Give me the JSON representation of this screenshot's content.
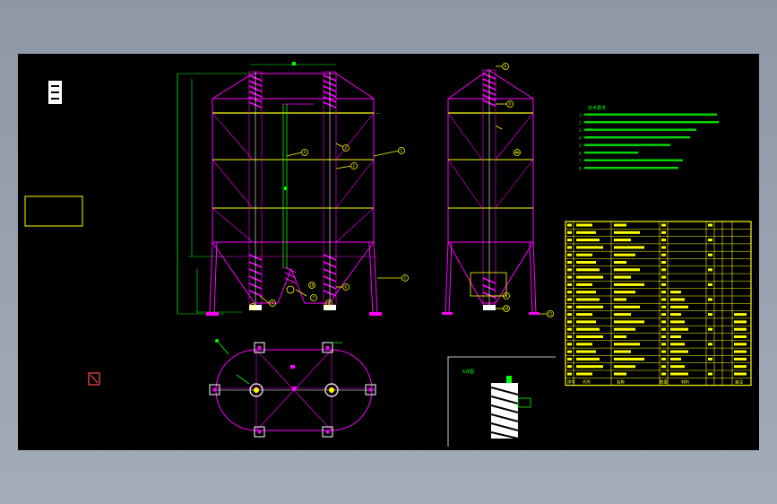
{
  "drawing": {
    "detail_label": "A详图",
    "notes_title": "技术要求",
    "notes": [
      "1.",
      "2.",
      "3.",
      "4.",
      "5.",
      "6.",
      "7.",
      "8."
    ],
    "balloons_front": [
      "1",
      "2",
      "3",
      "4",
      "5",
      "6",
      "7",
      "8",
      "9",
      "10",
      "11"
    ],
    "balloons_side": [
      "8",
      "9",
      "4",
      "5",
      "10",
      "11"
    ],
    "colors": {
      "background": "#000000",
      "magenta": "#ff00ff",
      "yellow": "#ffff00",
      "green": "#00ff00",
      "white": "#ffffff",
      "red": "#ff0000"
    },
    "table_footer": [
      "序号",
      "代号",
      "名称",
      "数量",
      "材料",
      "备注"
    ]
  }
}
